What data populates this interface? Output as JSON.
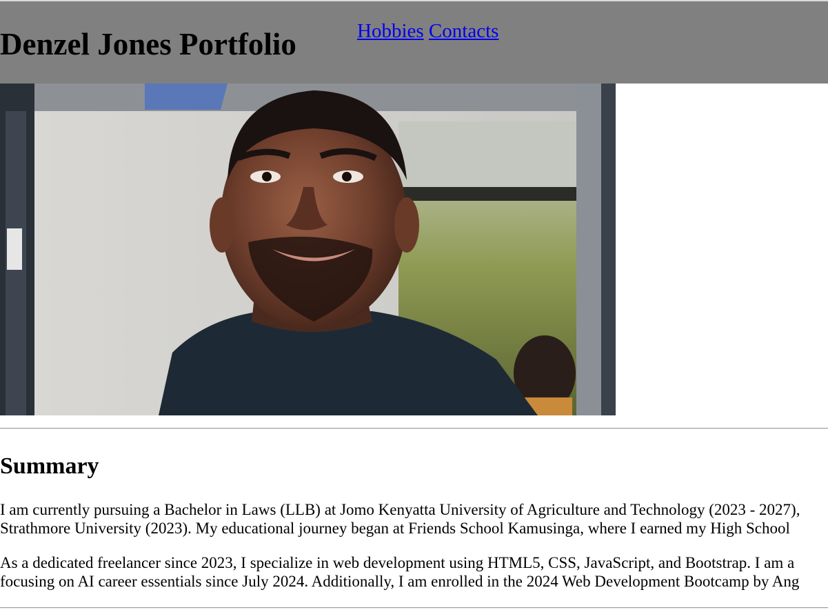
{
  "header": {
    "title": "Denzel Jones Portfolio",
    "bg_color": "#808080",
    "nav": [
      {
        "label": "Hobbies"
      },
      {
        "label": "Contacts"
      }
    ]
  },
  "photo": {
    "description_icon": "portrait-photo"
  },
  "summary": {
    "heading": "Summary",
    "paragraph1_line1": "I am currently pursuing a Bachelor in Laws (LLB) at Jomo Kenyatta University of Agriculture and Technology (2023 - 2027),",
    "paragraph1_line2": "Strathmore University (2023). My educational journey began at Friends School Kamusinga, where I earned my High School",
    "paragraph2_line1": "As a dedicated freelancer since 2023, I specialize in web development using HTML5, CSS, JavaScript, and Bootstrap. I am a",
    "paragraph2_line2": "focusing on AI career essentials since July 2024. Additionally, I am enrolled in the 2024 Web Development Bootcamp by Ang"
  },
  "colors": {
    "link": "#0000ee"
  }
}
